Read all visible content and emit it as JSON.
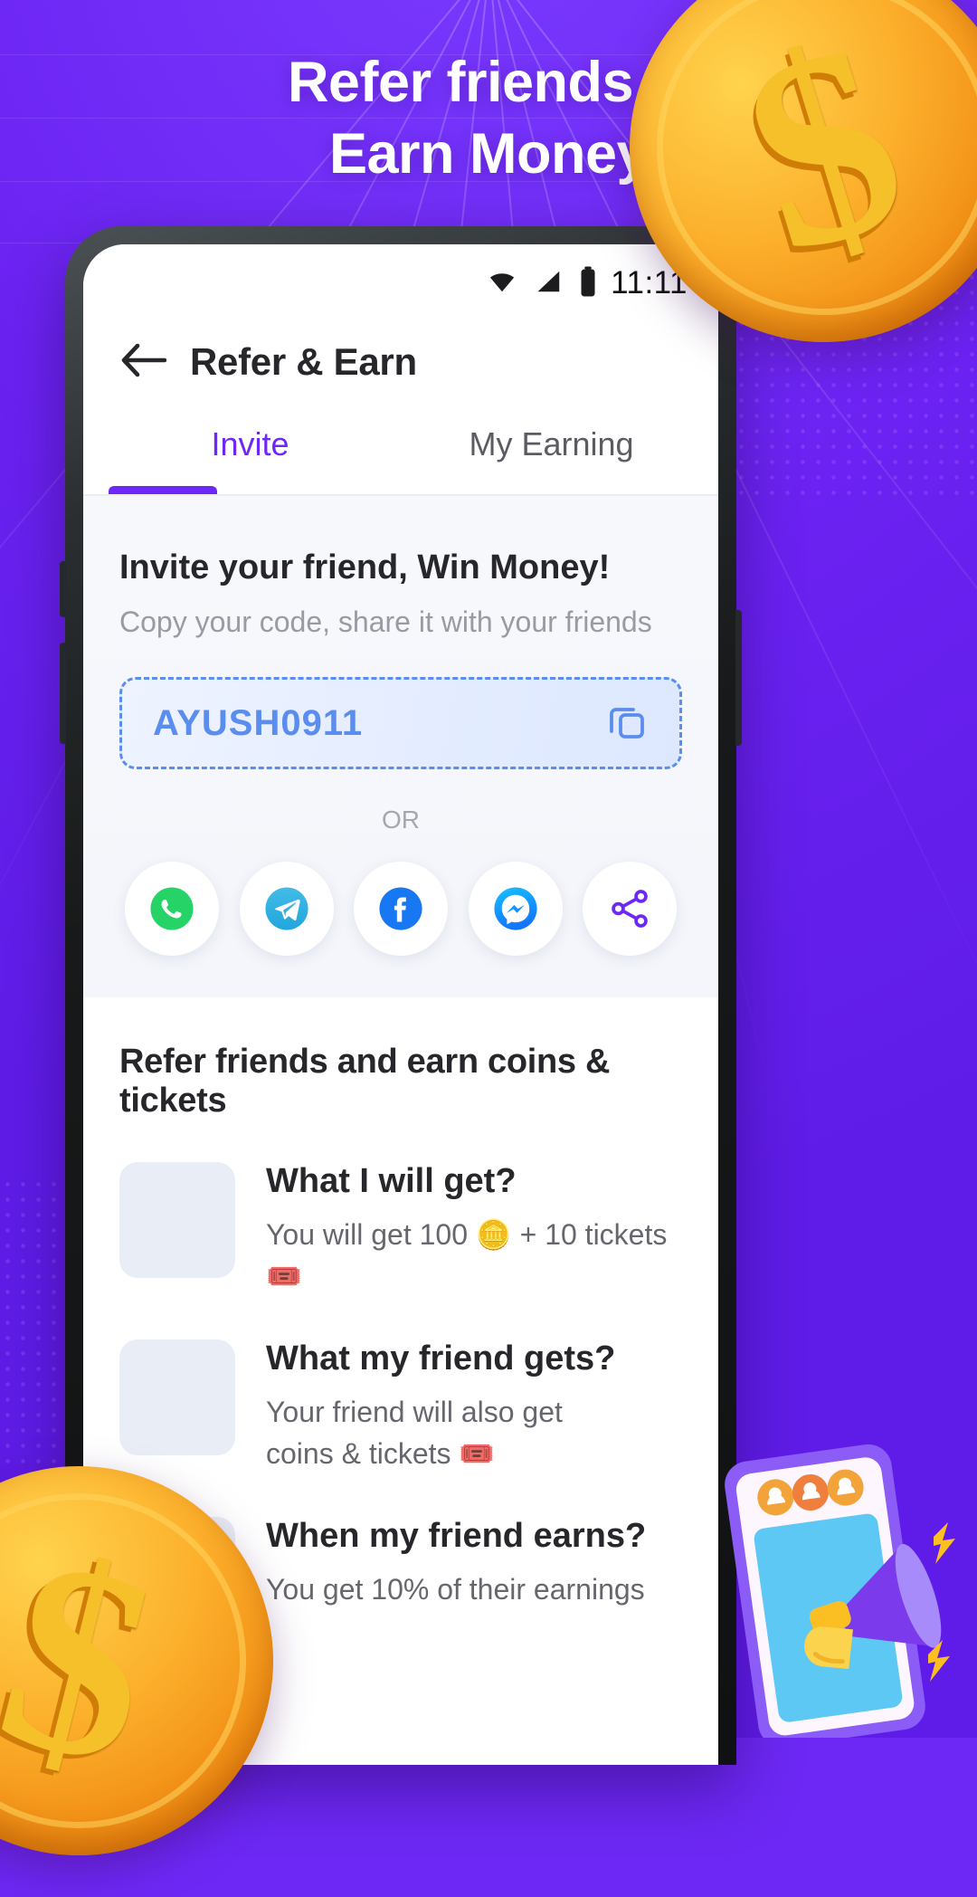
{
  "promo": {
    "headline_line1": "Refer friends &",
    "headline_line2": "Earn Money",
    "background_color": "#6d28f5",
    "coin_symbol": "$"
  },
  "status_bar": {
    "time": "11:11",
    "icons": [
      "wifi-icon",
      "cellular-signal-icon",
      "battery-icon"
    ]
  },
  "app_bar": {
    "back_icon": "arrow-left-icon",
    "title": "Refer & Earn"
  },
  "tabs": {
    "accent_color": "#6d28f5",
    "items": [
      {
        "label": "Invite",
        "active": true
      },
      {
        "label": "My Earning",
        "active": false
      }
    ]
  },
  "invite": {
    "heading": "Invite your friend, Win Money!",
    "subheading": "Copy your code, share it with your friends",
    "referral_code": "AYUSH0911",
    "code_color": "#5b8def",
    "copy_icon": "copy-icon",
    "or_label": "OR",
    "share_options": [
      {
        "name": "whatsapp",
        "color": "#25D366"
      },
      {
        "name": "telegram",
        "color": "#2AABEE"
      },
      {
        "name": "facebook",
        "color": "#1877F2"
      },
      {
        "name": "messenger",
        "color": "#0099FF"
      },
      {
        "name": "more-share",
        "color": "#6d28f5"
      }
    ]
  },
  "benefits": {
    "section_title": "Refer friends and earn coins & tickets",
    "items": [
      {
        "title": "What I will get?",
        "description": "You will get 100 🪙 + 10 tickets 🎟️"
      },
      {
        "title": "What my friend gets?",
        "description": "Your friend will also get coins & tickets 🎟️"
      },
      {
        "title": "When my friend earns?",
        "description": "You get 10% of their earnings"
      }
    ]
  }
}
